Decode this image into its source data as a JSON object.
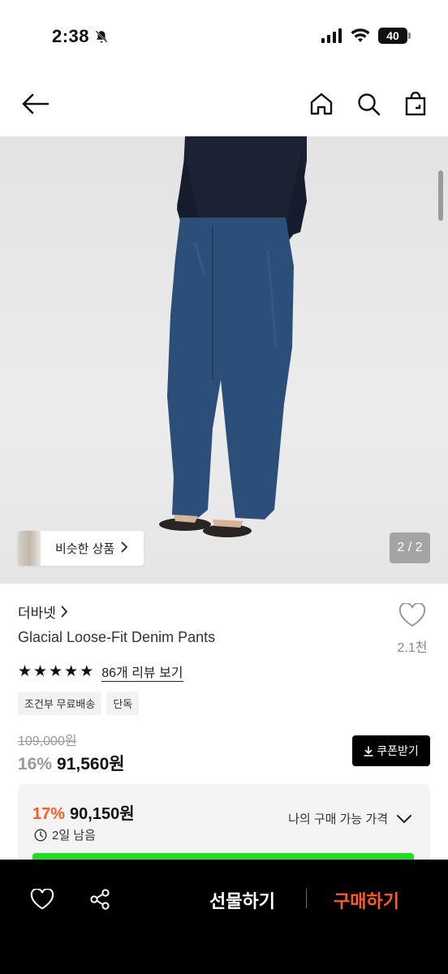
{
  "status": {
    "time": "2:38",
    "battery": "40"
  },
  "hero": {
    "similar_label": "비슷한 상품",
    "page_indicator": "2 / 2"
  },
  "product": {
    "brand": "더바넷",
    "title": "Glacial Loose-Fit Denim Pants",
    "likes": "2.1천",
    "rating_stars": 5,
    "review_link": "86개 리뷰 보기",
    "tags": [
      "조건부 무료배송",
      "단독"
    ],
    "original_price": "109,000원",
    "discount": "16%",
    "price": "91,560원",
    "coupon_label": "쿠폰받기"
  },
  "best_price": {
    "discount": "17%",
    "price": "90,150원",
    "time_left": "2일 남음",
    "my_price_label": "나의 구매 가능 가격"
  },
  "bottom": {
    "gift_label": "선물하기",
    "buy_label": "구매하기"
  },
  "colors": {
    "accent": "#ff5a1f",
    "green_bar": "#22dd22",
    "bottom_bg": "#000000"
  }
}
